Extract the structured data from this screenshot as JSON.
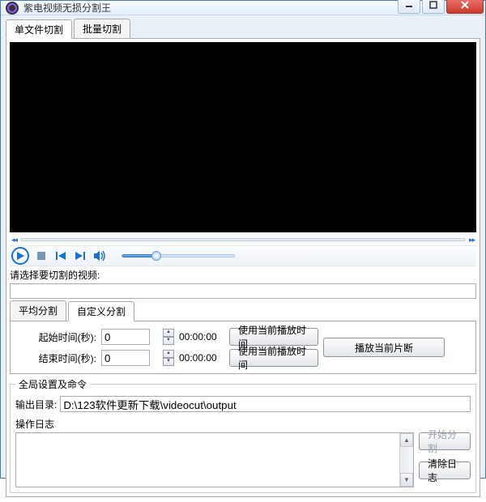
{
  "window": {
    "title": "紫电视频无损分割王"
  },
  "tabs": {
    "single": "单文件切割",
    "batch": "批量切割"
  },
  "select_video_label": "请选择要切割的视频:",
  "select_video_value": "",
  "subtabs": {
    "avg": "平均分割",
    "custom": "自定义分割"
  },
  "time": {
    "start_label": "起始时间(秒):",
    "start_value": "0",
    "start_display": "00:00:00",
    "end_label": "结束时间(秒):",
    "end_value": "0",
    "end_display": "00:00:00",
    "use_current_btn": "使用当前播放时间",
    "play_segment_btn": "播放当前片断"
  },
  "global": {
    "legend": "全局设置及命令",
    "outdir_label": "输出目录:",
    "outdir_value": "D:\\123软件更新下载\\videocut\\output",
    "log_label": "操作日志",
    "start_btn": "开始分割",
    "clear_log_btn": "清除日志"
  }
}
